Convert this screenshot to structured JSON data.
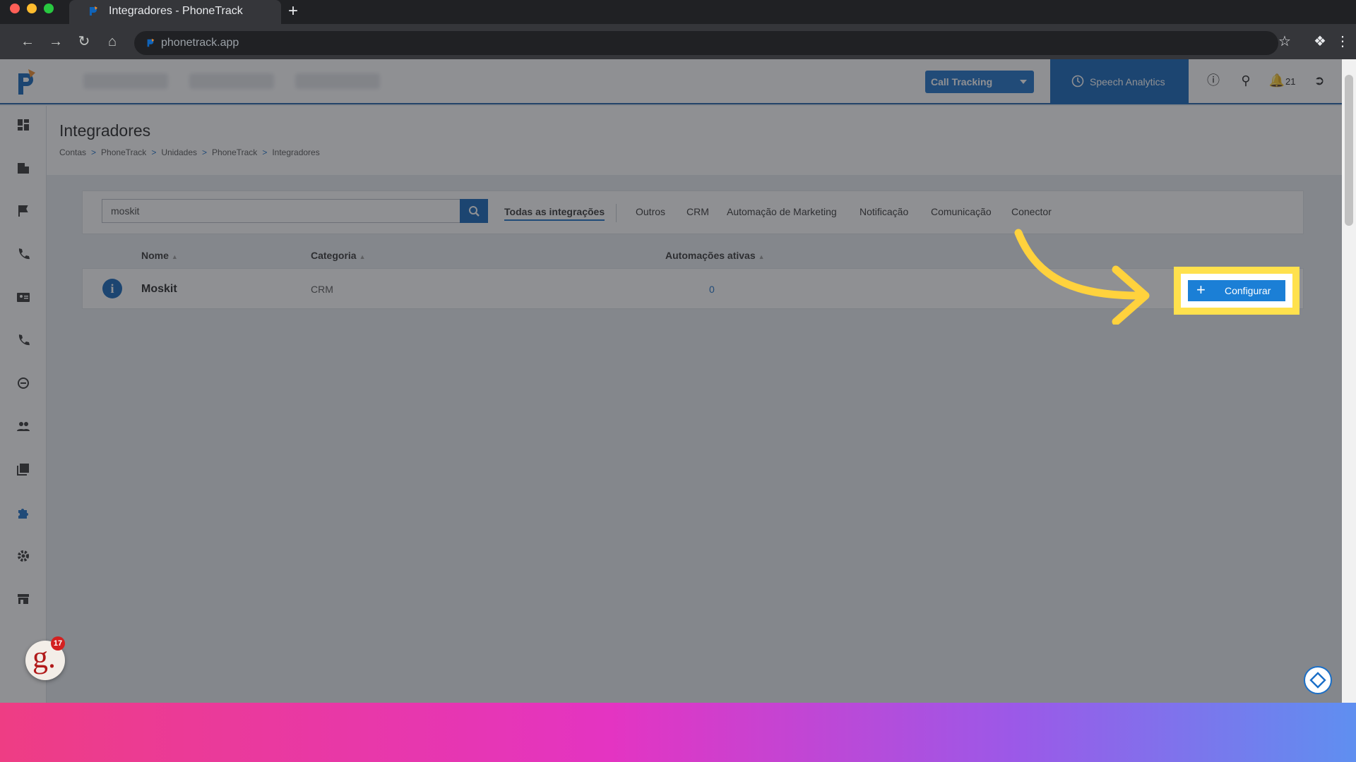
{
  "browser": {
    "tab_title": "Integradores - PhoneTrack",
    "new_tab": "+",
    "url": "phonetrack.app"
  },
  "topbar": {
    "product_select": "Call Tracking",
    "speech_analytics": "Speech Analytics",
    "notification_count": "21"
  },
  "page": {
    "title": "Integradores",
    "breadcrumb": [
      "Contas",
      "PhoneTrack",
      "Unidades",
      "PhoneTrack",
      "Integradores"
    ]
  },
  "search": {
    "value": "moskit"
  },
  "filter_tabs": [
    "Todas as integrações",
    "Outros",
    "CRM",
    "Automação de Marketing",
    "Notificação",
    "Comunicação",
    "Conector"
  ],
  "table": {
    "headers": [
      "Nome",
      "Categoria",
      "Automações ativas"
    ],
    "rows": [
      {
        "name": "Moskit",
        "category": "CRM",
        "active": "0",
        "action": "Configurar"
      }
    ]
  },
  "badge": {
    "letter": "g.",
    "count": "17"
  },
  "colors": {
    "accent": "#0f63b8",
    "highlight": "#ffe14d"
  }
}
